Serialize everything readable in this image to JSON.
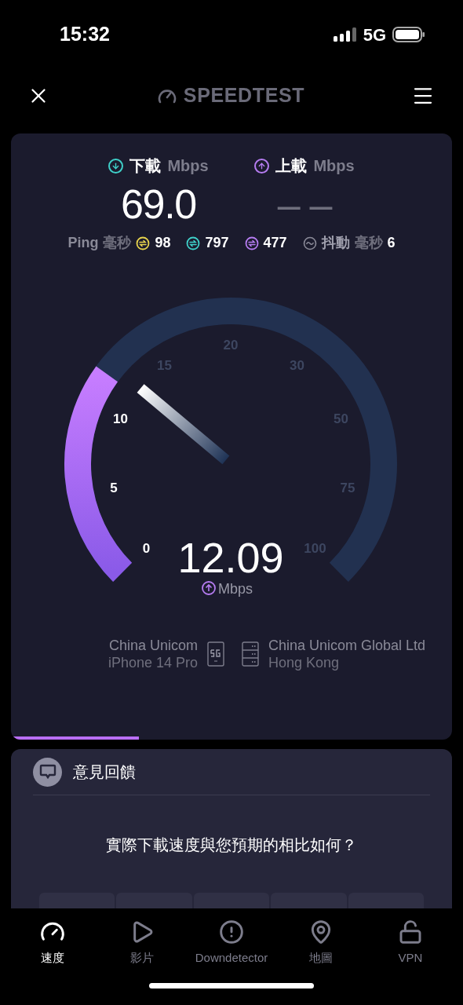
{
  "status_bar": {
    "time": "15:32",
    "network": "5G"
  },
  "header": {
    "logo": "SPEEDTEST"
  },
  "results": [
    {
      "kind": "download",
      "label": "下載",
      "unit": "Mbps",
      "value": "69.0",
      "color": "#3fd0c9"
    },
    {
      "kind": "upload",
      "label": "上載",
      "unit": "Mbps",
      "value": "– –",
      "color": "#b57cf0"
    }
  ],
  "ping": {
    "label": "Ping",
    "unit": "毫秒",
    "values": [
      {
        "value": "98",
        "color": "#e8d44d"
      },
      {
        "value": "797",
        "color": "#3fd0c9"
      },
      {
        "value": "477",
        "color": "#b57cf0"
      }
    ],
    "jitter_label": "抖動",
    "jitter_unit": "毫秒",
    "jitter": "6"
  },
  "gauge": {
    "ticks": [
      "0",
      "5",
      "10",
      "15",
      "20",
      "30",
      "50",
      "75",
      "100"
    ],
    "value": "12.09",
    "unit": "Mbps"
  },
  "connection": {
    "provider": "China Unicom",
    "device": "iPhone 14 Pro",
    "server": "China Unicom Global Ltd",
    "location": "Hong Kong"
  },
  "feedback": {
    "title": "意見回饋",
    "question": "實際下載速度與您預期的相比如何？"
  },
  "nav": [
    {
      "label": "速度",
      "selected": true
    },
    {
      "label": "影片",
      "selected": false
    },
    {
      "label": "Downdetector",
      "selected": false
    },
    {
      "label": "地圖",
      "selected": false
    },
    {
      "label": "VPN",
      "selected": false
    }
  ]
}
